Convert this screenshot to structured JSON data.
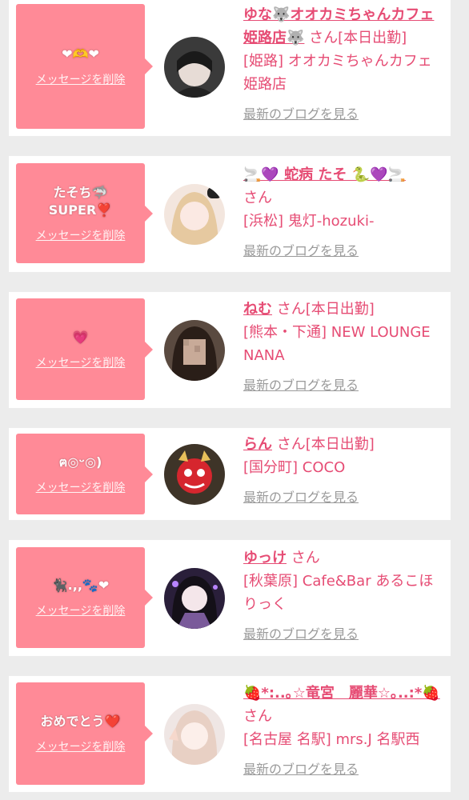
{
  "common": {
    "delete_label": "メッセージを削除",
    "blog_label": "最新のブログを見る",
    "san": "さん",
    "accent_color": "#e64c74",
    "bubble_color": "#ff8a97"
  },
  "cards": [
    {
      "message": "❤︎🫶❤︎",
      "name": "ゆな🐺オオカミちゃんカフェ姫路店🐺",
      "status": "[本日出勤]",
      "shop": "[姫路] オオカミちゃんカフェ姫路店"
    },
    {
      "message": "たそち🦈\nSUPER❣️",
      "name": "🚬💜 蛇病 たそ 🐍💜🚬",
      "status": "",
      "shop": "[浜松] 鬼灯-hozuki-"
    },
    {
      "message": "💗",
      "name": "ねむ",
      "status": "[本日出勤]",
      "shop": "[熊本・下通] NEW LOUNGE NANA"
    },
    {
      "message": "ฅ◎ᵕ◎)",
      "name": "らん",
      "status": "[本日出勤]",
      "shop": "[国分町] COCO"
    },
    {
      "message": "🐈‍⬛.,,🐾❤︎",
      "name": "ゆっけ",
      "status": "",
      "shop": "[秋葉原] Cafe&Bar あるこほりっく"
    },
    {
      "message": "おめでとう❤️",
      "name": "🍓*:..｡☆竜宮　麗華☆｡..:*🍓",
      "status": "",
      "shop": "[名古屋 名駅] mrs.J 名駅西"
    }
  ]
}
